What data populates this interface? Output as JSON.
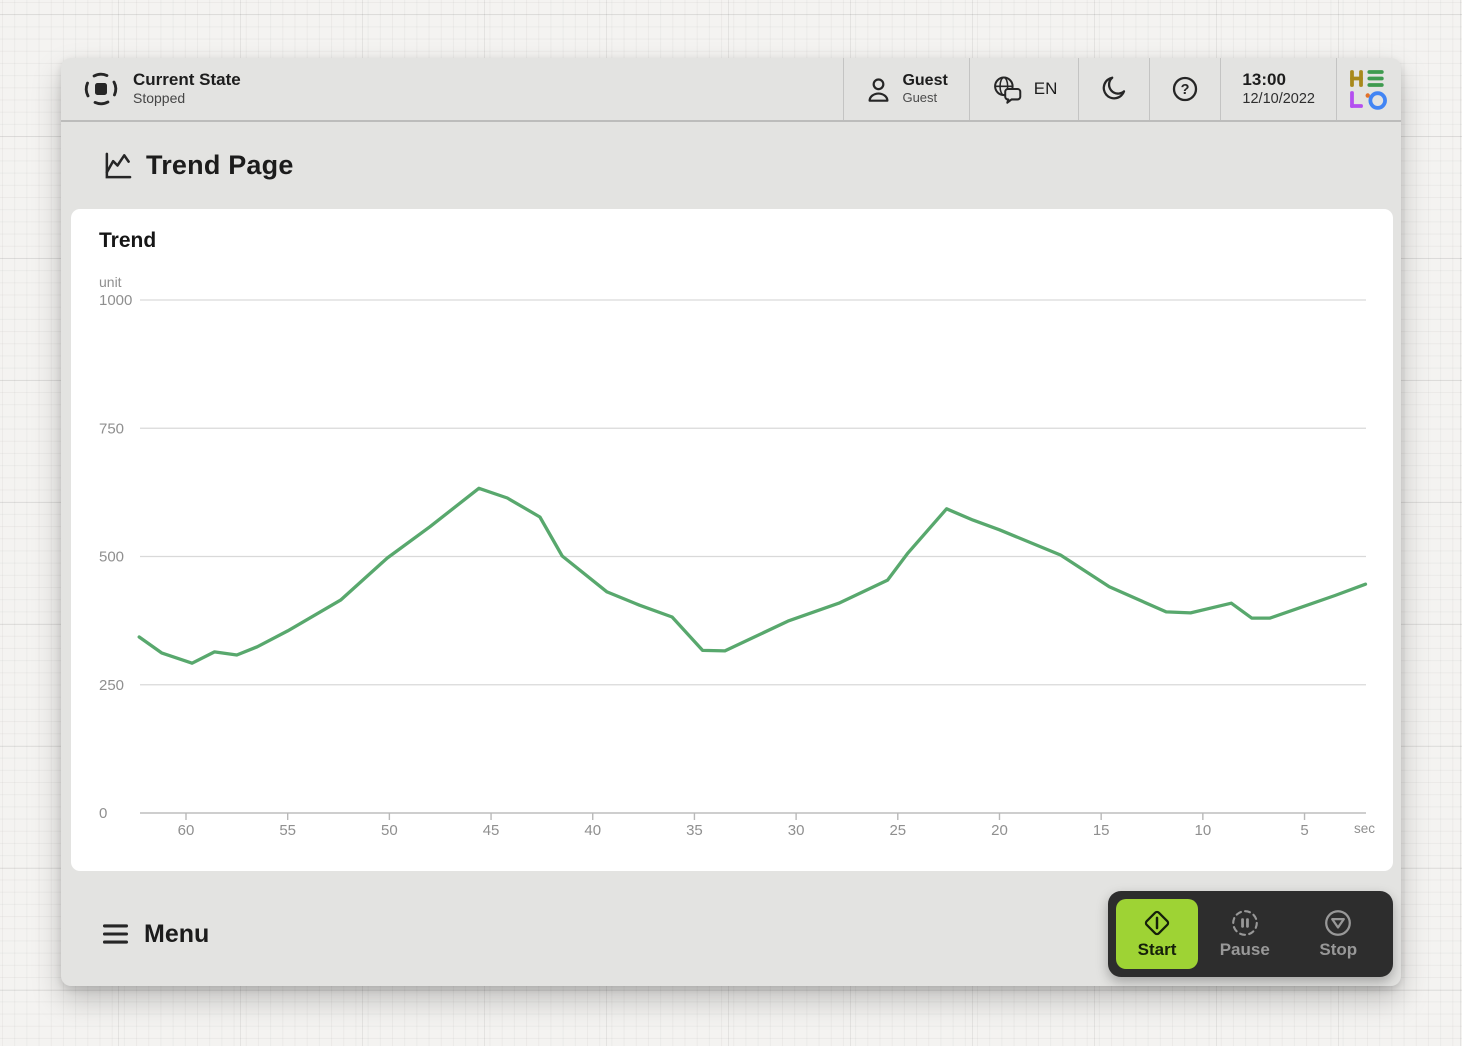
{
  "window": {
    "topbar": {
      "state": {
        "title": "Current State",
        "value": "Stopped"
      },
      "user": {
        "name": "Guest",
        "role": "Guest"
      },
      "language": "EN",
      "help_glyph": "?",
      "time": "13:00",
      "date": "12/10/2022",
      "logo_alt": "HELIO"
    },
    "page": {
      "title": "Trend Page"
    },
    "menu_label": "Menu",
    "controls": {
      "start": "Start",
      "pause": "Pause",
      "stop": "Stop"
    }
  },
  "chart_data": {
    "type": "line",
    "title": "Trend",
    "ylabel": "unit",
    "xlabel": "sec",
    "ylim": [
      0,
      1000
    ],
    "xlim": [
      62.3,
      2.0
    ],
    "x_reversed": true,
    "grid": true,
    "y_ticks": [
      1000,
      750,
      500,
      250,
      0
    ],
    "x_ticks": [
      60,
      55,
      50,
      45,
      40,
      35,
      30,
      25,
      20,
      15,
      10,
      5
    ],
    "line_color": "#58a86d",
    "points": [
      [
        62.3,
        343
      ],
      [
        61.2,
        312
      ],
      [
        59.7,
        292
      ],
      [
        58.6,
        314
      ],
      [
        57.5,
        308
      ],
      [
        56.5,
        324
      ],
      [
        55.0,
        355
      ],
      [
        52.4,
        415
      ],
      [
        50.1,
        497
      ],
      [
        48.0,
        558
      ],
      [
        45.6,
        633
      ],
      [
        44.2,
        614
      ],
      [
        42.6,
        577
      ],
      [
        41.5,
        501
      ],
      [
        39.3,
        431
      ],
      [
        37.7,
        405
      ],
      [
        36.1,
        382
      ],
      [
        34.6,
        317
      ],
      [
        33.5,
        316
      ],
      [
        30.4,
        374
      ],
      [
        27.9,
        409
      ],
      [
        25.5,
        454
      ],
      [
        24.5,
        507
      ],
      [
        22.6,
        593
      ],
      [
        21.3,
        571
      ],
      [
        20.0,
        552
      ],
      [
        17.0,
        503
      ],
      [
        14.6,
        441
      ],
      [
        11.8,
        392
      ],
      [
        10.6,
        390
      ],
      [
        8.6,
        409
      ],
      [
        7.6,
        380
      ],
      [
        6.7,
        380
      ],
      [
        5.1,
        402
      ],
      [
        3.5,
        424
      ],
      [
        2.0,
        446
      ]
    ]
  },
  "colors": {
    "accent_green": "#9ed334",
    "chart_line": "#58a86d",
    "panel_dark": "#2d2d2d",
    "logo_h": "#a8891c",
    "logo_bars": "#3f9b4f",
    "logo_l": "#b44ff0",
    "logo_dot": "#e2722a",
    "logo_o": "#4285f4"
  }
}
